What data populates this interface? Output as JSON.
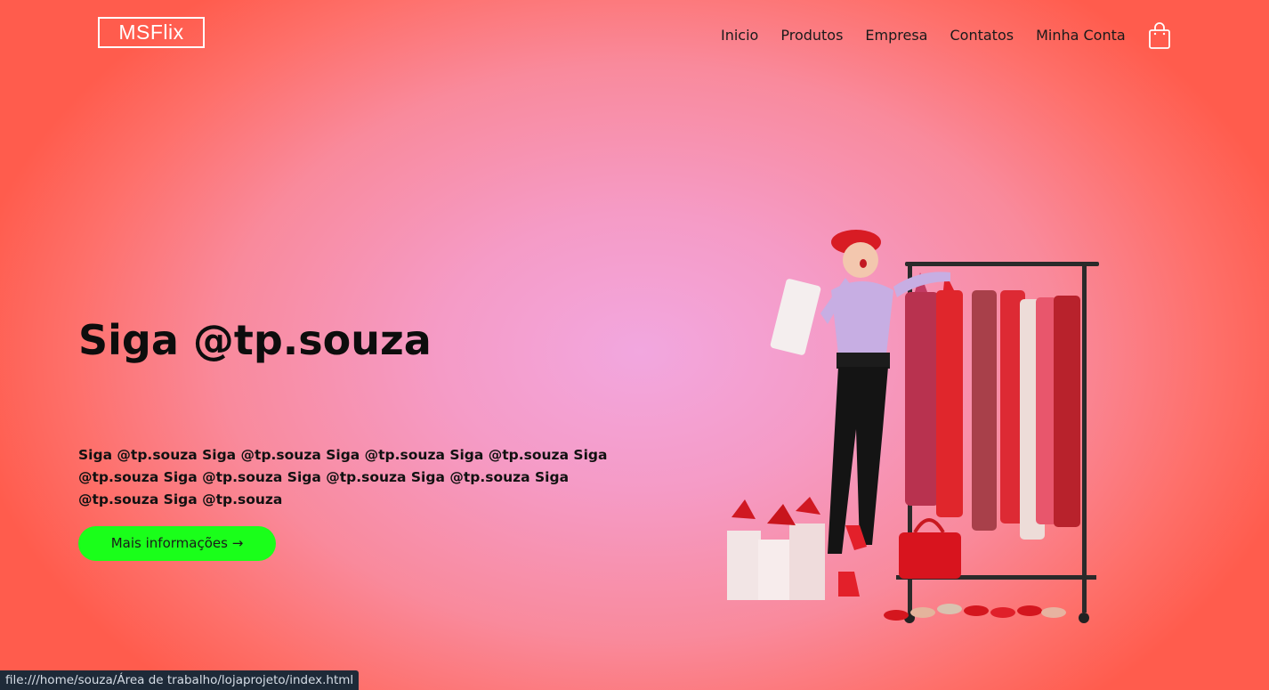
{
  "header": {
    "logo": "MSFlix",
    "nav": [
      "Inicio",
      "Produtos",
      "Empresa",
      "Contatos",
      "Minha Conta"
    ],
    "cart_icon": "shopping-bag-icon"
  },
  "hero": {
    "title": "Siga @tp.souza",
    "text": "Siga @tp.souza Siga @tp.souza Siga @tp.souza Siga @tp.souza Siga @tp.souza Siga @tp.souza Siga @tp.souza Siga @tp.souza Siga @tp.souza Siga @tp.souza",
    "button": "Mais informações →",
    "image_icon": "fashion-shopping-image"
  },
  "status_bar": {
    "url": "file:///home/souza/Área de trabalho/lojaprojeto/index.html"
  },
  "colors": {
    "accent_button": "#1aff1a",
    "background_center": "#f2a7df",
    "background_edge": "#ff5c4d"
  }
}
